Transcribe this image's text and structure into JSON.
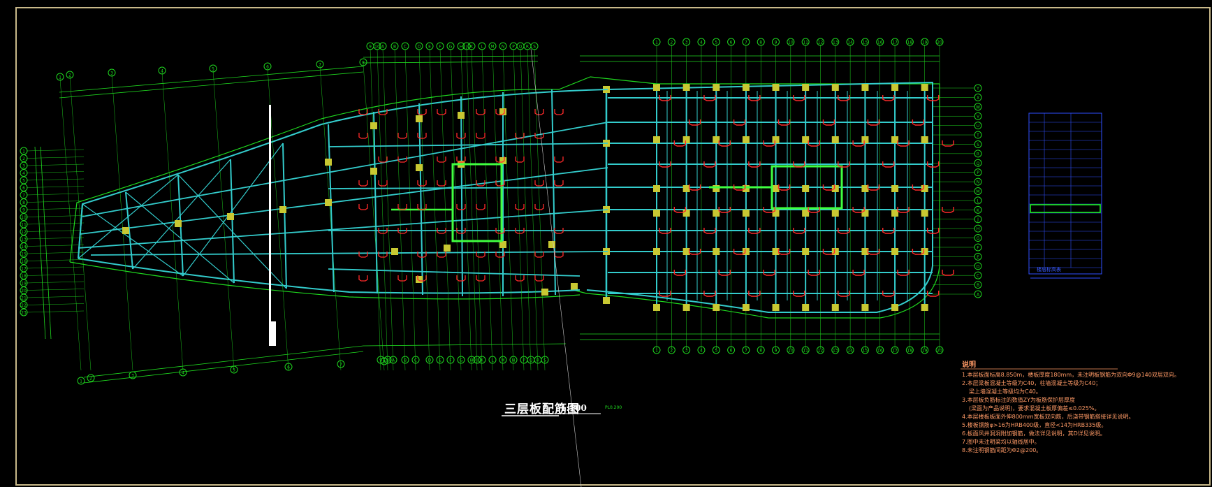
{
  "drawing": {
    "title": "三层板配筋图",
    "scale": "1:100",
    "tag": "PL0.200"
  },
  "notes": {
    "heading": "说明",
    "lines": [
      "1.本层板面标高8.850m，楼板厚度180mm，未注明板钢筋为双向Φ9@140双层双向。",
      "2.本层梁板混凝土等级为C40，柱墙混凝土等级为C40；",
      "  梁上墙混凝土等级均为C40。",
      "3.本层板负筋标注的数值ZY为板筋保护层厚度",
      "  (梁面为产品说明)，要求混凝土板厚偏差≤0.025%。",
      "4.本层楼板板面外伸800mm宽板双向筋，后浇带钢筋搭接详见说明。",
      "5.楼板钢筋φ>16为HRB400级，直径<14为HRB335级。",
      "6.板面风井洞洞附加钢筋，做法详见说明，其D详见说明。",
      "7.图中未注明梁均以轴线居中。",
      "8.未注明钢筋间距为Φ2@200。"
    ]
  },
  "legend": {
    "title": "楼层标高表",
    "rows": 17,
    "highlight_row": 10
  },
  "colors": {
    "background": "#000000",
    "frame": "#c9b98a",
    "axis_lines": "#1fd81f",
    "beams": "#33cccc",
    "columns": "#c8c832",
    "rebar": "#ff2a2a",
    "text": "#ffffff",
    "notes": "#ff9a66",
    "legend": "#2f4fff"
  },
  "axis_top_right": [
    "1",
    "2",
    "3",
    "4",
    "5",
    "6",
    "7",
    "8",
    "9",
    "10",
    "11",
    "12",
    "13",
    "14",
    "15",
    "16",
    "17",
    "18",
    "19",
    "20"
  ],
  "axis_right": [
    "Y",
    "X",
    "W",
    "V",
    "U",
    "T",
    "S",
    "R",
    "Q",
    "P",
    "N",
    "M",
    "L",
    "K",
    "J",
    "H",
    "G",
    "F",
    "E",
    "D",
    "C",
    "B",
    "A"
  ],
  "axis_left": [
    "1",
    "2",
    "3",
    "4",
    "5",
    "6",
    "7",
    "8",
    "9",
    "10",
    "11",
    "12",
    "13",
    "14",
    "15",
    "16",
    "17",
    "18",
    "19",
    "20",
    "21",
    "22",
    "23"
  ],
  "axis_top_left": [
    "1",
    "2",
    "3",
    "4",
    "5",
    "6",
    "7",
    "8",
    "9",
    "10",
    "A",
    "B",
    "C",
    "D",
    "E",
    "F",
    "G",
    "H",
    "J",
    "K",
    "L",
    "M",
    "N",
    "P",
    "Q",
    "R",
    "S",
    "T",
    "U",
    "V",
    "W",
    "X",
    "Y",
    "Z"
  ]
}
